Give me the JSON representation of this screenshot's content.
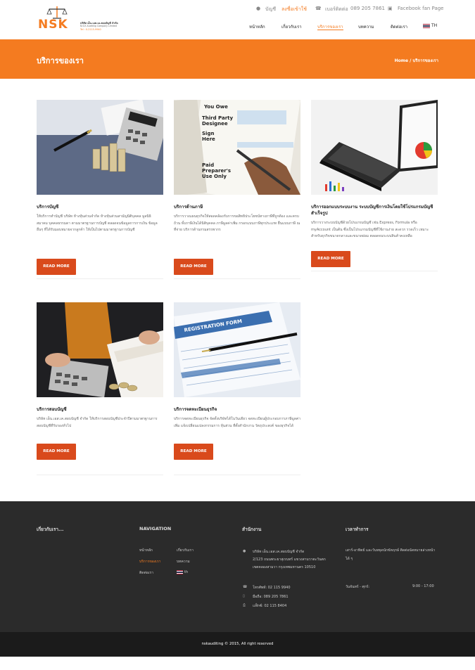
{
  "header": {
    "top": {
      "account_label": "บัญชี",
      "register": "ลงชื่อเข้าใช้",
      "phone_label": "เบอร์ติดต่อ",
      "phone": "089 205 7861",
      "facebook": "Facebook fan Page"
    },
    "logo": {
      "name": "NSK",
      "company": "บริษัท เอ็น.เอส.เค.สอบบัญชี จำกัด",
      "company_en": "N.S.K Auditing Company Limited",
      "tel": "Tel : 0-2115-9940"
    },
    "nav": [
      "หน้าหลัก",
      "เกี่ยวกับเรา",
      "บริการของเรา",
      "บทความ",
      "ติดต่อเรา",
      "TH"
    ]
  },
  "banner": {
    "title": "บริการของเรา",
    "breadcrumb_home": "Home",
    "breadcrumb_sep": "/",
    "breadcrumb_current": "บริการของเรา"
  },
  "services": [
    {
      "title": "บริการบัญชี",
      "desc": "ให้บริการทำบัญชี บริษัท ห้างหุ้นส่วนจำกัด ห้างหุ้นส่วนสามัญนิติบุคคล มูลนิธิ สมาคม บุคคลธรรมดา ตามมาตรฐานการบัญชี ตลอดจนข้อมูลการการเงิน ข้อมูลอื่นๆ ที่ได้รับมอบหมายจากลูกค้า ให้เป็นไปตามมาตรฐานการบัญชี",
      "button": "READ MORE"
    },
    {
      "title": "บริการด้านภาษี",
      "desc": "บริการวางแผนธุรกิจให้สอดคล้องกับการขอสิทธิประโยชน์ทางภาษีที่ถูกต้อง และครบถ้วน ทั้งภาษีเงินได้นิติบุคคล ภาษีมูลค่าเพิ่ม กรอกแบบภาษีทุกประเภท ยื่นแบบภาษี ณ ที่จ่าย บริการด้านกรมสรรพากร",
      "button": "READ MORE"
    },
    {
      "title": "บริการออกแบบระบบงาน ระบบบัญชีการเงินโดยใช้โปรแกรมบัญชีสำเร็จรูป",
      "desc": "บริการวางระบบบัญชีด้วยโปรแกรมบัญชี เช่น Express, Formula หรือ myAccount เป็นต้น ซึ่งเป็นโปรแกรมบัญชีที่ใช้งานง่าย สะดวก รวดเร็ว เหมาะสำหรับธุรกิจขนาดกลางและขนาดย่อม ตลอดจนระบบสินค้าคงเหลือ",
      "button": "READ MORE"
    },
    {
      "title": "บริการสอบบัญชี",
      "desc": "บริษัท เอ็น.เอส.เค.สอบบัญชี จำกัด ให้บริการสอบบัญชีประจำปีตามมาตรฐานการสอบบัญชีที่รับรองทั่วไป",
      "button": "READ MORE"
    },
    {
      "title": "บริการจดทะเบียนธุรกิจ",
      "desc": "บริการจดทะเบียนธุรกิจ จัดตั้งบริษัทได้ในวันเดียว จดทะเบียนผู้ประกอบการภาษีมูลค่าเพิ่ม แจ้งเปลี่ยนแปลงกรรมการ หุ้นส่วน ที่ตั้งสำนักงาน วัตถุประสงค์ ของธุรกิจได้",
      "button": "READ MORE"
    }
  ],
  "footer": {
    "about_title": "เกี่ยวกับเรา...",
    "nav_title": "NAVIGATION",
    "nav_items": [
      "หน้าหลัก",
      "เกี่ยวกับเรา",
      "บริการของเรา",
      "บทความ",
      "ติดต่อเรา",
      "th"
    ],
    "office_title": "สำนักงาน",
    "address": [
      "บริษัท เอ็น.เอส.เค.สอบบัญชี จำกัด",
      "2/123 ถนนพระยาสุเรนทร์ แขวงสามวาตะวันตก",
      "เขตคลองสามวา กรุงเทพมหานคร 10510"
    ],
    "phone": "โทรศัพท์: 02 115 9940",
    "mobile": "มือถือ: 089 205 7861",
    "fax": "แฟ็กซ์: 02 115 8404",
    "hours_title": "เวลาทำการ",
    "hours_note": [
      "เสาร์-อาทิตย์ และวันหยุดนักขัตฤกษ์ ติดต่อนัดหมายล่วงหน้า",
      "ได้ ๆ"
    ],
    "hours_days": "วันจันทร์ - ศุกร์:",
    "hours_time": "9:00 - 17:00",
    "copyright": "nskauditing © 2015, All right reserved"
  },
  "colors": {
    "accent": "#f47b20",
    "button": "#d94a1c",
    "footer": "#2b2b2b"
  }
}
